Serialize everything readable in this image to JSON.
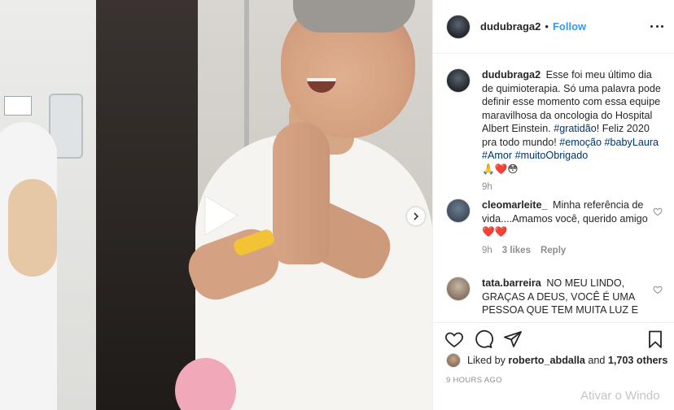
{
  "post": {
    "username": "dudubraga2",
    "follow_label": "Follow",
    "separator": "•"
  },
  "caption": {
    "username": "dudubraga2",
    "text_1": "Esse foi meu último dia de quimioterapia. Só uma palavra pode definir esse momento com essa equipe maravilhosa da oncologia do Hospital Albert Einstein. ",
    "tag_1": "#gratidão",
    "text_2": "! Feliz 2020 pra todo mundo! ",
    "tag_2": "#emoção",
    "tag_3": "#babyLaura",
    "tag_4": "#Amor",
    "tag_5": "#muitoObrigado",
    "emojis": "🙏❤️😳",
    "time": "9h"
  },
  "comments": [
    {
      "username": "cleomarleite_",
      "text": "Minha referência de vida....Amamos você, querido amigo ❤️❤️",
      "time": "9h",
      "likes": "3 likes",
      "reply_label": "Reply"
    },
    {
      "username": "tata.barreira",
      "text": "NO MEU LINDO, GRAÇAS A DEUS, VOCÊ É UMA PESSOA QUE TEM MUITA LUZ E"
    }
  ],
  "likes": {
    "prefix": "Liked by",
    "user": "roberto_abdalla",
    "and": "and",
    "count": "1,703 others"
  },
  "timestamp": "9 HOURS AGO",
  "watermark": "Ativar o Windo",
  "colors": {
    "link": "#3897f0",
    "hashtag": "#003569",
    "meta": "#8e8e8e"
  }
}
